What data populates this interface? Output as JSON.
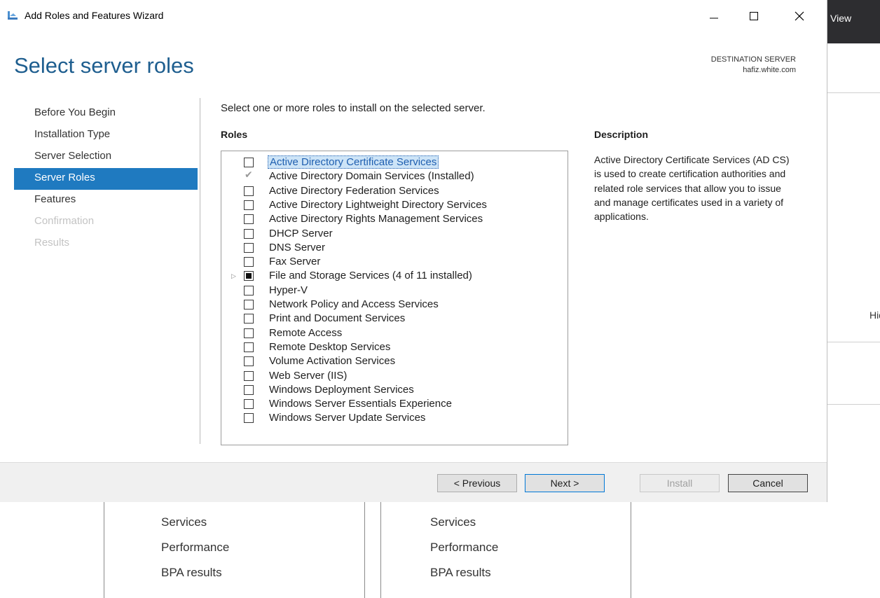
{
  "window": {
    "title": "Add Roles and Features Wizard",
    "controls": [
      "minimize",
      "maximize",
      "close"
    ]
  },
  "page_title": "Select server roles",
  "destination": {
    "label": "DESTINATION SERVER",
    "server": "hafiz.white.com"
  },
  "nav": [
    {
      "label": "Before You Begin",
      "state": "normal"
    },
    {
      "label": "Installation Type",
      "state": "normal"
    },
    {
      "label": "Server Selection",
      "state": "normal"
    },
    {
      "label": "Server Roles",
      "state": "active"
    },
    {
      "label": "Features",
      "state": "normal"
    },
    {
      "label": "Confirmation",
      "state": "disabled"
    },
    {
      "label": "Results",
      "state": "disabled"
    }
  ],
  "instruction": "Select one or more roles to install on the selected server.",
  "roles_heading": "Roles",
  "roles": [
    {
      "label": "Active Directory Certificate Services",
      "state": "unchecked",
      "selected": true
    },
    {
      "label": "Active Directory Domain Services (Installed)",
      "state": "checked-disabled"
    },
    {
      "label": "Active Directory Federation Services",
      "state": "unchecked"
    },
    {
      "label": "Active Directory Lightweight Directory Services",
      "state": "unchecked"
    },
    {
      "label": "Active Directory Rights Management Services",
      "state": "unchecked"
    },
    {
      "label": "DHCP Server",
      "state": "unchecked"
    },
    {
      "label": "DNS Server",
      "state": "unchecked"
    },
    {
      "label": "Fax Server",
      "state": "unchecked"
    },
    {
      "label": "File and Storage Services (4 of 11 installed)",
      "state": "partial",
      "expandable": true
    },
    {
      "label": "Hyper-V",
      "state": "unchecked"
    },
    {
      "label": "Network Policy and Access Services",
      "state": "unchecked"
    },
    {
      "label": "Print and Document Services",
      "state": "unchecked"
    },
    {
      "label": "Remote Access",
      "state": "unchecked"
    },
    {
      "label": "Remote Desktop Services",
      "state": "unchecked"
    },
    {
      "label": "Volume Activation Services",
      "state": "unchecked"
    },
    {
      "label": "Web Server (IIS)",
      "state": "unchecked"
    },
    {
      "label": "Windows Deployment Services",
      "state": "unchecked"
    },
    {
      "label": "Windows Server Essentials Experience",
      "state": "unchecked"
    },
    {
      "label": "Windows Server Update Services",
      "state": "unchecked"
    }
  ],
  "description_heading": "Description",
  "description": "Active Directory Certificate Services (AD CS) is used to create certification authorities and related role services that allow you to issue and manage certificates used in a variety of applications.",
  "buttons": {
    "previous": "< Previous",
    "next": "Next >",
    "install": "Install",
    "cancel": "Cancel"
  },
  "background": {
    "view_label": "View",
    "hide_label": "Hide",
    "tiles": [
      [
        "Services",
        "Performance",
        "BPA results"
      ],
      [
        "Services",
        "Performance",
        "BPA results"
      ]
    ]
  },
  "colors": {
    "accent": "#1f7ac0",
    "title": "#1e5e8f",
    "footer": "#f0f0f0"
  }
}
